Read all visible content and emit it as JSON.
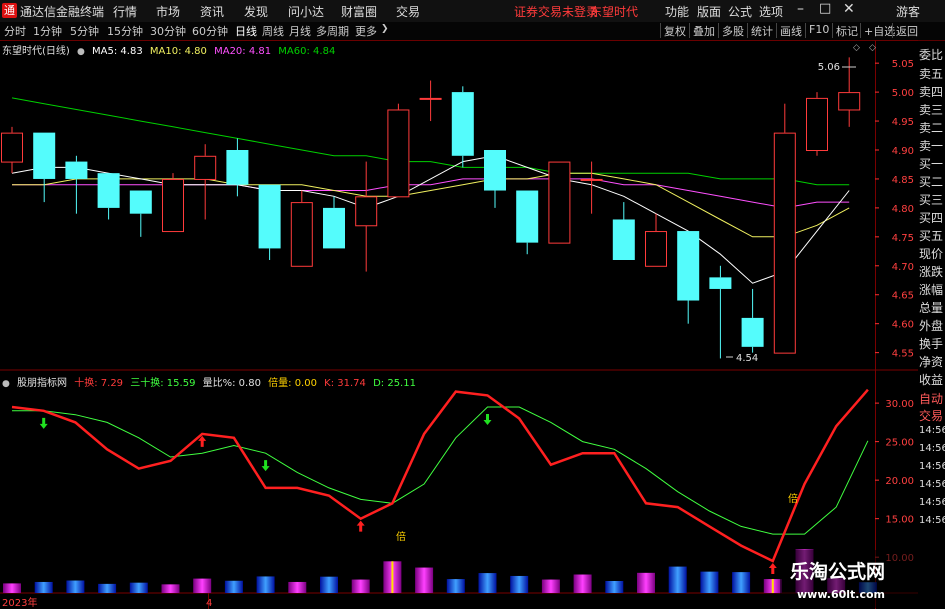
{
  "app": {
    "title": "通达信金融终端",
    "status_login": "证券交易未登录",
    "stock_name_top": "东望时代"
  },
  "menu": {
    "items": [
      "行情",
      "市场",
      "资讯",
      "发现",
      "问小达",
      "财富圈",
      "交易"
    ],
    "right_items": [
      "功能",
      "版面",
      "公式",
      "选项"
    ],
    "guest": "游客"
  },
  "toolbar": {
    "periods": [
      "分时",
      "1分钟",
      "5分钟",
      "15分钟",
      "30分钟",
      "60分钟",
      "日线",
      "周线",
      "月线",
      "多周期",
      "更多"
    ],
    "active_period": "日线",
    "right_buttons": [
      "复权",
      "叠加",
      "多股",
      "统计",
      "画线",
      "F10",
      "标记",
      "+自选",
      "返回"
    ]
  },
  "main_legend": {
    "title": "东望时代(日线)",
    "ma5": "MA5: 4.83",
    "ma10": "MA10: 4.80",
    "ma20": "MA20: 4.81",
    "ma60": "MA60: 4.84"
  },
  "sub_legend": {
    "name": "股朋指标网",
    "ten": "十换: 7.29",
    "thirty": "三十换: 15.59",
    "ratio": "量比%: 0.80",
    "bei": "倍量: 0.00",
    "k": "K: 31.74",
    "d": "D: 25.11"
  },
  "side_panel": {
    "items": [
      "委比",
      "卖五",
      "卖四",
      "卖三",
      "卖二",
      "卖一",
      "买一",
      "买二",
      "买三",
      "买四",
      "买五",
      "现价",
      "涨跌",
      "涨幅",
      "总量",
      "外盘",
      "换手",
      "净资",
      "收益"
    ],
    "auto_trade": [
      "自动",
      "交易"
    ],
    "times": [
      "14:56",
      "14:56",
      "14:56",
      "14:56",
      "14:56",
      "14:56"
    ]
  },
  "axis": {
    "price_ticks": [
      "5.05",
      "5.00",
      "4.95",
      "4.90",
      "4.85",
      "4.80",
      "4.75",
      "4.70",
      "4.65",
      "4.60",
      "4.55"
    ],
    "ind_ticks": [
      "30.00",
      "25.00",
      "20.00",
      "15.00",
      "10.00"
    ],
    "dates": [
      "2023年",
      "4"
    ],
    "high_label": "5.06",
    "low_label": "4.54",
    "bei_mark": "倍"
  },
  "watermark": {
    "name": "乐淘公式网",
    "url": "www.60lt.com"
  },
  "colors": {
    "up": "#ff3b3b",
    "down": "#54fcfc",
    "ma5": "#ffffff",
    "ma10": "#f0f060",
    "ma20": "#ff50ff",
    "ma60": "#00d000",
    "kline": "#ff2020",
    "dline": "#40ff40",
    "bg": "#000000",
    "grid": "#7a0000"
  },
  "chart_data": [
    {
      "type": "candlestick",
      "title": "东望时代(日线)",
      "ylim": [
        4.52,
        5.09
      ],
      "candles": [
        {
          "o": 4.88,
          "h": 4.94,
          "l": 4.86,
          "c": 4.93
        },
        {
          "o": 4.93,
          "h": 4.93,
          "l": 4.81,
          "c": 4.85
        },
        {
          "o": 4.88,
          "h": 4.89,
          "l": 4.79,
          "c": 4.85
        },
        {
          "o": 4.86,
          "h": 4.86,
          "l": 4.78,
          "c": 4.8
        },
        {
          "o": 4.83,
          "h": 4.83,
          "l": 4.75,
          "c": 4.79
        },
        {
          "o": 4.76,
          "h": 4.86,
          "l": 4.76,
          "c": 4.85
        },
        {
          "o": 4.85,
          "h": 4.91,
          "l": 4.78,
          "c": 4.89
        },
        {
          "o": 4.9,
          "h": 4.92,
          "l": 4.82,
          "c": 4.84
        },
        {
          "o": 4.84,
          "h": 4.84,
          "l": 4.71,
          "c": 4.73
        },
        {
          "o": 4.7,
          "h": 4.83,
          "l": 4.7,
          "c": 4.81
        },
        {
          "o": 4.8,
          "h": 4.82,
          "l": 4.73,
          "c": 4.73
        },
        {
          "o": 4.77,
          "h": 4.88,
          "l": 4.69,
          "c": 4.82
        },
        {
          "o": 4.82,
          "h": 4.98,
          "l": 4.82,
          "c": 4.97
        },
        {
          "o": 4.99,
          "h": 5.02,
          "l": 4.95,
          "c": 4.99
        },
        {
          "o": 5.0,
          "h": 5.01,
          "l": 4.87,
          "c": 4.89
        },
        {
          "o": 4.9,
          "h": 4.9,
          "l": 4.8,
          "c": 4.83
        },
        {
          "o": 4.83,
          "h": 4.83,
          "l": 4.72,
          "c": 4.74
        },
        {
          "o": 4.74,
          "h": 4.88,
          "l": 4.74,
          "c": 4.88
        },
        {
          "o": 4.85,
          "h": 4.88,
          "l": 4.79,
          "c": 4.85
        },
        {
          "o": 4.78,
          "h": 4.81,
          "l": 4.71,
          "c": 4.71
        },
        {
          "o": 4.7,
          "h": 4.79,
          "l": 4.7,
          "c": 4.76
        },
        {
          "o": 4.76,
          "h": 4.76,
          "l": 4.6,
          "c": 4.64
        },
        {
          "o": 4.68,
          "h": 4.7,
          "l": 4.54,
          "c": 4.66
        },
        {
          "o": 4.61,
          "h": 4.66,
          "l": 4.55,
          "c": 4.56
        },
        {
          "o": 4.55,
          "h": 4.98,
          "l": 4.55,
          "c": 4.93
        },
        {
          "o": 4.9,
          "h": 5.0,
          "l": 4.89,
          "c": 4.99
        },
        {
          "o": 4.97,
          "h": 5.06,
          "l": 4.94,
          "c": 5.0
        }
      ],
      "ma5": [
        4.86,
        4.87,
        4.87,
        4.86,
        4.85,
        4.84,
        4.84,
        4.84,
        4.83,
        4.83,
        4.82,
        4.8,
        4.82,
        4.85,
        4.88,
        4.89,
        4.87,
        4.85,
        4.84,
        4.82,
        4.79,
        4.76,
        4.72,
        4.67,
        4.69,
        4.76,
        4.83
      ],
      "ma10": [
        4.84,
        4.84,
        4.85,
        4.85,
        4.85,
        4.85,
        4.85,
        4.84,
        4.84,
        4.84,
        4.83,
        4.82,
        4.82,
        4.83,
        4.84,
        4.85,
        4.85,
        4.86,
        4.86,
        4.85,
        4.84,
        4.81,
        4.78,
        4.75,
        4.75,
        4.77,
        4.8
      ],
      "ma20": [
        4.84,
        4.84,
        4.84,
        4.84,
        4.84,
        4.84,
        4.84,
        4.84,
        4.83,
        4.83,
        4.83,
        4.83,
        4.84,
        4.84,
        4.85,
        4.85,
        4.85,
        4.85,
        4.85,
        4.84,
        4.84,
        4.83,
        4.82,
        4.81,
        4.8,
        4.81,
        4.81
      ],
      "ma60": [
        4.99,
        4.98,
        4.97,
        4.96,
        4.95,
        4.94,
        4.93,
        4.92,
        4.91,
        4.9,
        4.89,
        4.89,
        4.88,
        4.88,
        4.87,
        4.87,
        4.87,
        4.86,
        4.86,
        4.86,
        4.86,
        4.86,
        4.85,
        4.85,
        4.85,
        4.84,
        4.84
      ],
      "high_point": {
        "index": 26,
        "value": 5.06
      },
      "low_point": {
        "index": 22,
        "value": 4.54
      }
    },
    {
      "type": "line",
      "title": "股朋指标网",
      "ylim": [
        6,
        33
      ],
      "k": [
        29.5,
        29,
        27.5,
        24,
        21.5,
        22.5,
        26,
        25.5,
        19,
        19,
        18,
        15,
        17,
        26,
        31.5,
        31,
        28,
        22,
        23.5,
        23.5,
        17,
        16.5,
        14,
        11.5,
        9.5,
        19.5,
        27,
        31.74
      ],
      "d": [
        29,
        29,
        28.5,
        27.5,
        25.5,
        23,
        23.5,
        24.5,
        23.5,
        21,
        19,
        17.5,
        17,
        19.5,
        25.5,
        29.5,
        29.5,
        27.5,
        25,
        24,
        21.5,
        18.5,
        16,
        14,
        13,
        13,
        16.5,
        25.11
      ],
      "arrows_up": [
        6,
        11,
        24
      ],
      "arrows_down": [
        1,
        8,
        15
      ],
      "volume": [
        4,
        4.6,
        5.2,
        3.8,
        4.3,
        3.6,
        6,
        5.1,
        6.9,
        4.6,
        6.8,
        5.6,
        13.2,
        10.6,
        5.8,
        8.3,
        7.1,
        5.6,
        7.7,
        5,
        8.4,
        11,
        8.9,
        8.7,
        5.8,
        18.2,
        6.2,
        4.5
      ]
    }
  ]
}
